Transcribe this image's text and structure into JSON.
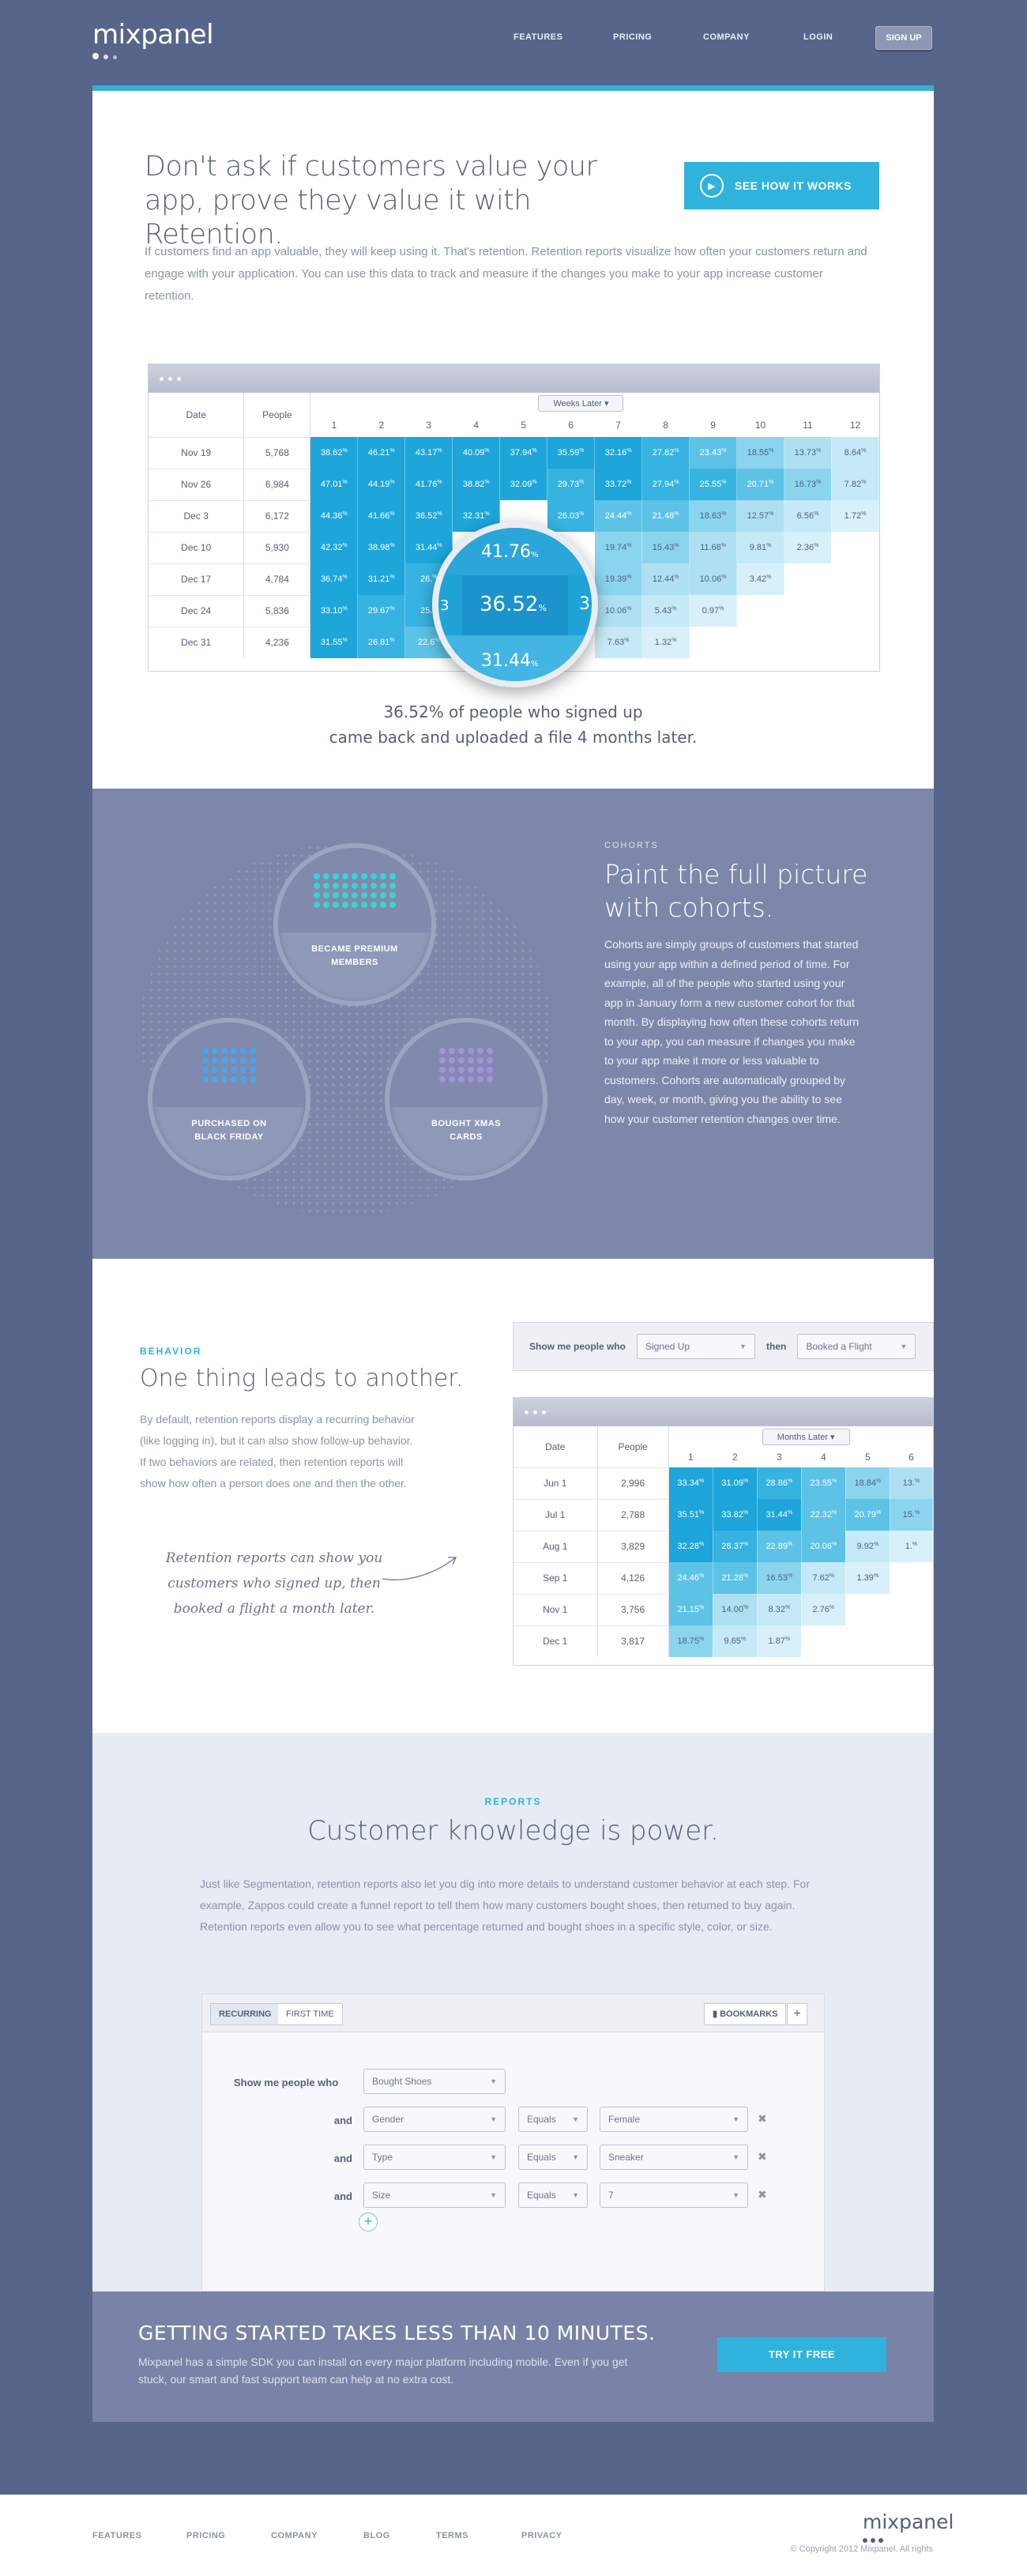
{
  "header": {
    "logo": "mixpanel",
    "nav": [
      "FEATURES",
      "PRICING",
      "COMPANY",
      "LOGIN"
    ],
    "signup": "SIGN UP"
  },
  "hero": {
    "title": "Don't ask if customers value your app, prove they value it with Retention.",
    "cta": "SEE HOW IT WORKS",
    "intro": "If customers find an app valuable, they will keep using it. That's retention. Retention reports visualize how often your customers return and engage with your application. You can use this data to track and measure if the changes you make to your app increase customer retention.",
    "table": {
      "col_date": "Date",
      "col_people": "People",
      "select": "Weeks Later",
      "weeks": [
        "1",
        "2",
        "3",
        "4",
        "5",
        "6",
        "7",
        "8",
        "9",
        "10",
        "11",
        "12"
      ],
      "rows": [
        {
          "date": "Nov 19",
          "people": "5,768",
          "cells": [
            "38.62",
            "46.21",
            "43.17",
            "40.09",
            "37.94",
            "35.59",
            "32.16",
            "27.82",
            "23.43",
            "18.55",
            "13.73",
            "8.64"
          ]
        },
        {
          "date": "Nov 26",
          "people": "6,984",
          "cells": [
            "47.01",
            "44.19",
            "41.76",
            "38.82",
            "32.09",
            "29.73",
            "33.72",
            "27.94",
            "25.55",
            "20.71",
            "16.73",
            "7.82"
          ]
        },
        {
          "date": "Dec 3",
          "people": "6,172",
          "cells": [
            "44.36",
            "41.66",
            "36.52",
            "32.31",
            "",
            "26.03",
            "24.44",
            "21.48",
            "18.63",
            "12.57",
            "6.56",
            "1.72"
          ]
        },
        {
          "date": "Dec 10",
          "people": "5,930",
          "cells": [
            "42.32",
            "38.98",
            "31.44",
            "",
            "",
            "",
            "19.74",
            "15.43",
            "11.68",
            "9.81",
            "2.36",
            ""
          ]
        },
        {
          "date": "Dec 17",
          "people": "4,784",
          "cells": [
            "36.74",
            "31.21",
            "26.",
            "",
            "",
            "",
            "19.39",
            "12.44",
            "10.06",
            "3.42",
            "",
            ""
          ]
        },
        {
          "date": "Dec 24",
          "people": "5,836",
          "cells": [
            "33.10",
            "29.67",
            "25.",
            "",
            "",
            "",
            "10.06",
            "5.43",
            "0.97",
            "",
            "",
            ""
          ]
        },
        {
          "date": "Dec 31",
          "people": "4,236",
          "cells": [
            "31.55",
            "26.81",
            "22.6",
            "",
            "",
            "",
            "7.63",
            "1.32",
            "",
            "",
            "",
            ""
          ]
        }
      ]
    },
    "magnifier": {
      "top": "41.76",
      "center": "36.52",
      "bottom": "31.44",
      "left": "3",
      "right": "3"
    },
    "caption_line1": "36.52% of people who signed up",
    "caption_line2": "came back and uploaded a file 4 months later."
  },
  "cohorts": {
    "kicker": "COHORTS",
    "title": "Paint the full picture with cohorts.",
    "body": "Cohorts are simply groups of customers that started using your app within a defined period of time. For example, all of the people who started using your app in January form a new customer cohort for that month. By displaying how often these cohorts return to your app, you can measure if changes you make to your app make it more or less valuable to customers. Cohorts are automatically grouped by day, week, or month, giving you the ability to see how your customer retention changes over time.",
    "circles": [
      {
        "label1": "BECAME PREMIUM",
        "label2": "MEMBERS",
        "color": "#3ad3d3"
      },
      {
        "label1": "PURCHASED ON",
        "label2": "BLACK FRIDAY",
        "color": "#4aa6ec"
      },
      {
        "label1": "BOUGHT XMAS",
        "label2": "CARDS",
        "color": "#a98fe0"
      }
    ]
  },
  "behavior": {
    "kicker": "BEHAVIOR",
    "title": "One thing leads to another.",
    "body": "By default, retention reports display a recurring behavior (like logging in), but it can also show follow-up behavior. If two behaviors are related, then retention reports will show how often a person does one and then the other.",
    "note": "Retention reports can show you customers who signed up, then booked a flight a month later.",
    "show_label": "Show me people who",
    "select1": "Signed Up",
    "then_label": "then",
    "select2": "Booked a Flight",
    "table": {
      "col_date": "Date",
      "col_people": "People",
      "select": "Months Later",
      "months": [
        "1",
        "2",
        "3",
        "4",
        "5",
        "6"
      ],
      "rows": [
        {
          "date": "Jun 1",
          "people": "2,996",
          "cells": [
            "33.34",
            "31.09",
            "28.86",
            "23.55",
            "18.84",
            "13."
          ]
        },
        {
          "date": "Jul 1",
          "people": "2,788",
          "cells": [
            "35.51",
            "33.82",
            "31.44",
            "22.32",
            "20.79",
            "15."
          ]
        },
        {
          "date": "Aug 1",
          "people": "3,829",
          "cells": [
            "32.28",
            "28.37",
            "22.89",
            "20.06",
            "9.92",
            "1."
          ]
        },
        {
          "date": "Sep 1",
          "people": "4,126",
          "cells": [
            "24.46",
            "21.28",
            "16.53",
            "7.62",
            "1.39",
            ""
          ]
        },
        {
          "date": "Nov 1",
          "people": "3,756",
          "cells": [
            "21.15",
            "14.00",
            "8.32",
            "2.76",
            "",
            ""
          ]
        },
        {
          "date": "Dec 1",
          "people": "3,817",
          "cells": [
            "18.75",
            "9.65",
            "1.87",
            "",
            "",
            ""
          ]
        }
      ]
    }
  },
  "reports": {
    "kicker": "REPORTS",
    "title": "Customer knowledge is power.",
    "body": "Just like Segmentation, retention reports also let you dig into more details to understand customer behavior at each step. For example, Zappos could create a funnel report to tell them how many customers bought shoes, then returned to buy again. Retention reports even allow you to see what percentage returned and bought shoes in a specific style, color, or size.",
    "tab_recurring": "RECURRING",
    "tab_first": "FIRST TIME",
    "bookmarks": "BOOKMARKS",
    "show_label": "Show me people who",
    "event": "Bought Shoes",
    "and": "and",
    "filters": [
      {
        "prop": "Gender",
        "op": "Equals",
        "value": "Female"
      },
      {
        "prop": "Type",
        "op": "Equals",
        "value": "Sneaker"
      },
      {
        "prop": "Size",
        "op": "Equals",
        "value": "7"
      }
    ]
  },
  "getting_started": {
    "title": "GETTING STARTED TAKES LESS THAN 10 MINUTES.",
    "body": "Mixpanel has a simple SDK you can install on every major platform including mobile. Even if you get stuck, our smart and fast support team can help at no extra cost.",
    "cta": "TRY IT FREE"
  },
  "footer": {
    "nav": [
      "FEATURES",
      "PRICING",
      "COMPANY",
      "BLOG",
      "TERMS",
      "PRIVACY"
    ],
    "logo": "mixpanel",
    "copyright": "© Copyright 2012 Mixpanel. All rights"
  }
}
